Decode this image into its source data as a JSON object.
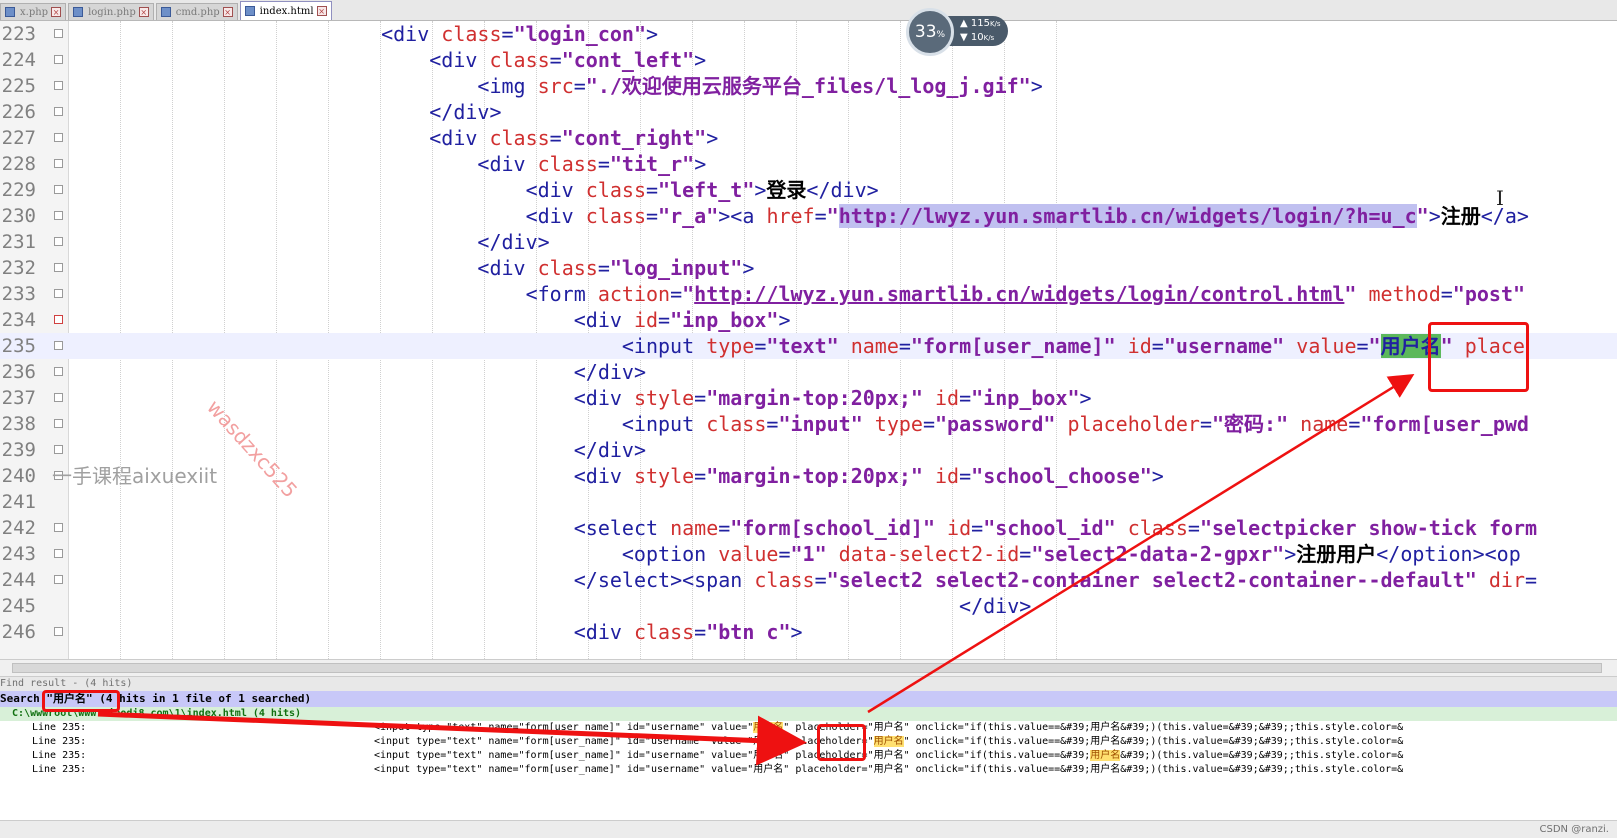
{
  "tabs": [
    {
      "label": "x.php"
    },
    {
      "label": "login.php"
    },
    {
      "label": "cmd.php"
    },
    {
      "label": "index.html",
      "active": true
    }
  ],
  "editor": {
    "lines": [
      {
        "num": "223",
        "html": "                          <span class=\"t\">&lt;div</span> <span class=\"a\">class</span><span class=\"t\">=</span><span class=\"v\">\"login_con\"</span><span class=\"t\">&gt;</span>"
      },
      {
        "num": "224",
        "html": "                              <span class=\"t\">&lt;div</span> <span class=\"a\">class</span><span class=\"t\">=</span><span class=\"v\">\"cont_left\"</span><span class=\"t\">&gt;</span>"
      },
      {
        "num": "225",
        "html": "                                  <span class=\"t\">&lt;img</span> <span class=\"a\">src</span><span class=\"t\">=</span><span class=\"v\">\"./欢迎使用云服务平台_files/l_log_j.gif\"</span><span class=\"t\">&gt;</span>"
      },
      {
        "num": "226",
        "html": "                              <span class=\"t\">&lt;/div&gt;</span>"
      },
      {
        "num": "227",
        "html": "                              <span class=\"t\">&lt;div</span> <span class=\"a\">class</span><span class=\"t\">=</span><span class=\"v\">\"cont_right\"</span><span class=\"t\">&gt;</span>"
      },
      {
        "num": "228",
        "html": "                                  <span class=\"t\">&lt;div</span> <span class=\"a\">class</span><span class=\"t\">=</span><span class=\"v\">\"tit_r\"</span><span class=\"t\">&gt;</span>"
      },
      {
        "num": "229",
        "html": "                                      <span class=\"t\">&lt;div</span> <span class=\"a\">class</span><span class=\"t\">=</span><span class=\"v\">\"left_t\"</span><span class=\"t\">&gt;</span><span class=\"tx\">登录</span><span class=\"t\">&lt;/div&gt;</span>"
      },
      {
        "num": "230",
        "html": "                                      <span class=\"t\">&lt;div</span> <span class=\"a\">class</span><span class=\"t\">=</span><span class=\"v\">\"r_a\"</span><span class=\"t\">&gt;&lt;a</span> <span class=\"a\">href</span><span class=\"t\">=</span><span class=\"v\">\"<span class=\"hl-sel\">http://lwyz.yun.smartlib.cn/widgets/login/?h=u_c</span>\"</span><span class=\"t\">&gt;</span><span class=\"tx\">注册</span><span class=\"t\">&lt;/a&gt;</span>"
      },
      {
        "num": "231",
        "html": "                                  <span class=\"t\">&lt;/div&gt;</span>"
      },
      {
        "num": "232",
        "html": "                                  <span class=\"t\">&lt;div</span> <span class=\"a\">class</span><span class=\"t\">=</span><span class=\"v\">\"log_input\"</span><span class=\"t\">&gt;</span>"
      },
      {
        "num": "233",
        "html": "                                      <span class=\"t\">&lt;form</span> <span class=\"a\">action</span><span class=\"t\">=</span><span class=\"v\">\"<u>http://lwyz.yun.smartlib.cn/widgets/login/control.html</u>\"</span> <span class=\"a\">method</span><span class=\"t\">=</span><span class=\"v\">\"post\"</span>"
      },
      {
        "num": "234",
        "html": "                                          <span class=\"t\">&lt;div</span> <span class=\"a\">id</span><span class=\"t\">=</span><span class=\"v\">\"inp_box\"</span><span class=\"t\">&gt;</span>"
      },
      {
        "num": "235",
        "html": "                                              <span class=\"t\">&lt;input</span> <span class=\"a\">type</span><span class=\"t\">=</span><span class=\"v\">\"text\"</span> <span class=\"a\">name</span><span class=\"t\">=</span><span class=\"v\">\"form[user_name]\"</span> <span class=\"a\">id</span><span class=\"t\">=</span><span class=\"v\">\"username\"</span> <span class=\"a\">value</span><span class=\"t\">=</span><span class=\"v\">\"<span class=\"hl-green\">用户名</span>\"</span> <span class=\"a\">place</span>"
      },
      {
        "num": "236",
        "html": "                                          <span class=\"t\">&lt;/div&gt;</span>"
      },
      {
        "num": "237",
        "html": "                                          <span class=\"t\">&lt;div</span> <span class=\"a\">style</span><span class=\"t\">=</span><span class=\"v\">\"margin-top:20px;\"</span> <span class=\"a\">id</span><span class=\"t\">=</span><span class=\"v\">\"inp_box\"</span><span class=\"t\">&gt;</span>"
      },
      {
        "num": "238",
        "html": "                                              <span class=\"t\">&lt;input</span> <span class=\"a\">class</span><span class=\"t\">=</span><span class=\"v\">\"input\"</span> <span class=\"a\">type</span><span class=\"t\">=</span><span class=\"v\">\"password\"</span> <span class=\"a\">placeholder</span><span class=\"t\">=</span><span class=\"v\">\"密码:\"</span> <span class=\"a\">name</span><span class=\"t\">=</span><span class=\"v\">\"form[user_pwd</span>"
      },
      {
        "num": "239",
        "html": "                                          <span class=\"t\">&lt;/div&gt;</span>"
      },
      {
        "num": "240",
        "html": "                                          <span class=\"t\">&lt;div</span> <span class=\"a\">style</span><span class=\"t\">=</span><span class=\"v\">\"margin-top:20px;\"</span> <span class=\"a\">id</span><span class=\"t\">=</span><span class=\"v\">\"school_choose\"</span><span class=\"t\">&gt;</span>"
      },
      {
        "num": "241",
        "html": ""
      },
      {
        "num": "242",
        "html": "                                          <span class=\"t\">&lt;select</span> <span class=\"a\">name</span><span class=\"t\">=</span><span class=\"v\">\"form[school_id]\"</span> <span class=\"a\">id</span><span class=\"t\">=</span><span class=\"v\">\"school_id\"</span> <span class=\"a\">class</span><span class=\"t\">=</span><span class=\"v\">\"selectpicker show-tick form</span>"
      },
      {
        "num": "243",
        "html": "                                              <span class=\"t\">&lt;option</span> <span class=\"a\">value</span><span class=\"t\">=</span><span class=\"v\">\"1\"</span> <span class=\"a\">data-select2-id</span><span class=\"t\">=</span><span class=\"v\">\"select2-data-2-gpxr\"</span><span class=\"t\">&gt;</span><span class=\"tx\">注册用户</span><span class=\"t\">&lt;/option&gt;&lt;op</span>"
      },
      {
        "num": "244",
        "html": "                                          <span class=\"t\">&lt;/select&gt;&lt;span</span> <span class=\"a\">class</span><span class=\"t\">=</span><span class=\"v\">\"select2 select2-container select2-container--default\"</span> <span class=\"a\">dir</span><span class=\"t\">=</span>"
      },
      {
        "num": "245",
        "html": "                                                                          <span class=\"t\">&lt;/div&gt;</span>"
      },
      {
        "num": "246",
        "html": "                                          <span class=\"t\">&lt;div</span> <span class=\"a\">class</span><span class=\"t\">=</span><span class=\"v\">\"btn c\"</span><span class=\"t\">&gt;</span>"
      }
    ]
  },
  "speed_widget": {
    "percent": "33",
    "percent_sign": "%",
    "upload": "115",
    "upload_unit": "K/s",
    "download": "10",
    "download_unit": "K/s"
  },
  "watermarks": {
    "diagonal": "wasdzxc525",
    "course": "一手课程aixuexiit"
  },
  "find_results": {
    "title": "Find result - (4 hits)",
    "search_line": "Search \"用户名\" (4 hits in 1 file of 1 searched)",
    "file_line": "  C:\\wwwroot\\www.xiaodi8.com\\1\\index.html (4 hits)",
    "lines": [
      {
        "label": "Line 235:",
        "html": "&lt;input type=\"text\" name=\"form[user_name]\" id=\"username\" value=\"<span class=\"ho\">用户名</span>\" placeholder=\"用户名\" onclick=\"if(this.value==&amp;#39;用户名&amp;#39;)(this.value=&amp;#39;&amp;#39;;this.style.color=&amp;"
      },
      {
        "label": "Line 235:",
        "html": "&lt;input type=\"text\" name=\"form[user_name]\" id=\"username\" value=\"用户名\" placeholder=\"<span class=\"ho\">用户名</span>\" onclick=\"if(this.value==&amp;#39;用户名&amp;#39;)(this.value=&amp;#39;&amp;#39;;this.style.color=&amp;"
      },
      {
        "label": "Line 235:",
        "html": "&lt;input type=\"text\" name=\"form[user_name]\" id=\"username\" value=\"用户名\" placeholder=\"用户名\" onclick=\"if(this.value==&amp;#39;<span class=\"ho\">用户名</span>&amp;#39;)(this.value=&amp;#39;&amp;#39;;this.style.color=&amp;"
      },
      {
        "label": "Line 235:",
        "html": "&lt;input type=\"text\" name=\"form[user_name]\" id=\"username\" value=\"用户名\" placeholder=\"用户名\" onclick=\"if(this.value==&amp;#39;用户名&amp;#39;)(this.value=&amp;#39;&amp;#39;;this.style.color=&amp;"
      }
    ]
  },
  "credit": "CSDN @ranzi.",
  "colors": {
    "tag": "#2020a0",
    "attr": "#d03030",
    "value": "#8020a0",
    "annotation": "#ee1111"
  }
}
